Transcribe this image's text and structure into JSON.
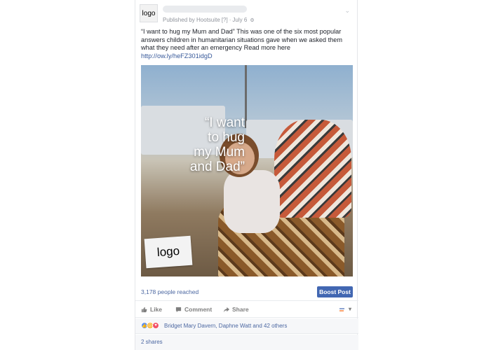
{
  "post": {
    "avatar_label": "logo",
    "published_by": "Published by Hootsuite",
    "help_marker": "[?]",
    "date_sep": "·",
    "date": "July 6",
    "text": "“I want to hug my Mum and Dad” This was one of the six most popular answers children in humanitarian situations gave when we asked them what they need after an emergency Read more here",
    "link": "http://ow.ly/heFZ301idgD"
  },
  "photo": {
    "quote": "“I want\nto hug\nmy Mum\nand Dad”",
    "logo_label": "logo"
  },
  "stats": {
    "reach": "3,178 people reached",
    "boost_label": "Boost Post"
  },
  "actions": {
    "like": "Like",
    "comment": "Comment",
    "share": "Share"
  },
  "reactions": {
    "names": "Bridget Mary Davern, Daphne Watt and 42 others"
  },
  "shares": {
    "count": "2 shares"
  },
  "colors": {
    "link": "#365899",
    "boost": "#4267b2",
    "like": "#5890ff",
    "sad": "#f7b125",
    "love": "#f25268"
  }
}
